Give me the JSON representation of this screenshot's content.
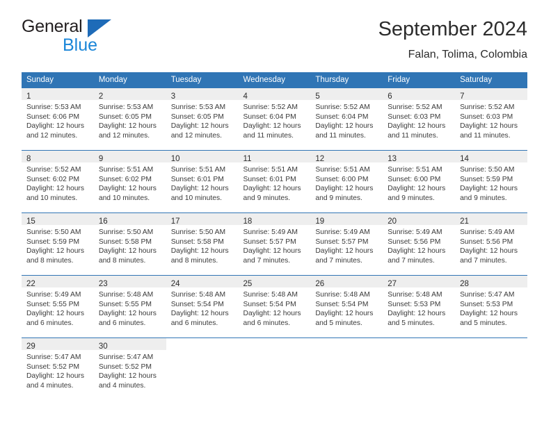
{
  "brand": {
    "word_general": "General",
    "word_blue": "Blue",
    "triangle_color": "#1e6bb8",
    "blue_text_color": "#1b86d8"
  },
  "header": {
    "title": "September 2024",
    "location": "Falan, Tolima, Colombia"
  },
  "theme": {
    "header_blue": "#3075b5",
    "daynum_band": "#eeeeee",
    "text": "#3a3a3a"
  },
  "weekday_headers": [
    "Sunday",
    "Monday",
    "Tuesday",
    "Wednesday",
    "Thursday",
    "Friday",
    "Saturday"
  ],
  "labels": {
    "sunrise_prefix": "Sunrise:",
    "sunset_prefix": "Sunset:",
    "daylight_prefix": "Daylight:"
  },
  "weeks": [
    [
      {
        "day": "1",
        "sunrise": "Sunrise: 5:53 AM",
        "sunset": "Sunset: 6:06 PM",
        "daylight_1": "Daylight: 12 hours",
        "daylight_2": "and 12 minutes."
      },
      {
        "day": "2",
        "sunrise": "Sunrise: 5:53 AM",
        "sunset": "Sunset: 6:05 PM",
        "daylight_1": "Daylight: 12 hours",
        "daylight_2": "and 12 minutes."
      },
      {
        "day": "3",
        "sunrise": "Sunrise: 5:53 AM",
        "sunset": "Sunset: 6:05 PM",
        "daylight_1": "Daylight: 12 hours",
        "daylight_2": "and 12 minutes."
      },
      {
        "day": "4",
        "sunrise": "Sunrise: 5:52 AM",
        "sunset": "Sunset: 6:04 PM",
        "daylight_1": "Daylight: 12 hours",
        "daylight_2": "and 11 minutes."
      },
      {
        "day": "5",
        "sunrise": "Sunrise: 5:52 AM",
        "sunset": "Sunset: 6:04 PM",
        "daylight_1": "Daylight: 12 hours",
        "daylight_2": "and 11 minutes."
      },
      {
        "day": "6",
        "sunrise": "Sunrise: 5:52 AM",
        "sunset": "Sunset: 6:03 PM",
        "daylight_1": "Daylight: 12 hours",
        "daylight_2": "and 11 minutes."
      },
      {
        "day": "7",
        "sunrise": "Sunrise: 5:52 AM",
        "sunset": "Sunset: 6:03 PM",
        "daylight_1": "Daylight: 12 hours",
        "daylight_2": "and 11 minutes."
      }
    ],
    [
      {
        "day": "8",
        "sunrise": "Sunrise: 5:52 AM",
        "sunset": "Sunset: 6:02 PM",
        "daylight_1": "Daylight: 12 hours",
        "daylight_2": "and 10 minutes."
      },
      {
        "day": "9",
        "sunrise": "Sunrise: 5:51 AM",
        "sunset": "Sunset: 6:02 PM",
        "daylight_1": "Daylight: 12 hours",
        "daylight_2": "and 10 minutes."
      },
      {
        "day": "10",
        "sunrise": "Sunrise: 5:51 AM",
        "sunset": "Sunset: 6:01 PM",
        "daylight_1": "Daylight: 12 hours",
        "daylight_2": "and 10 minutes."
      },
      {
        "day": "11",
        "sunrise": "Sunrise: 5:51 AM",
        "sunset": "Sunset: 6:01 PM",
        "daylight_1": "Daylight: 12 hours",
        "daylight_2": "and 9 minutes."
      },
      {
        "day": "12",
        "sunrise": "Sunrise: 5:51 AM",
        "sunset": "Sunset: 6:00 PM",
        "daylight_1": "Daylight: 12 hours",
        "daylight_2": "and 9 minutes."
      },
      {
        "day": "13",
        "sunrise": "Sunrise: 5:51 AM",
        "sunset": "Sunset: 6:00 PM",
        "daylight_1": "Daylight: 12 hours",
        "daylight_2": "and 9 minutes."
      },
      {
        "day": "14",
        "sunrise": "Sunrise: 5:50 AM",
        "sunset": "Sunset: 5:59 PM",
        "daylight_1": "Daylight: 12 hours",
        "daylight_2": "and 9 minutes."
      }
    ],
    [
      {
        "day": "15",
        "sunrise": "Sunrise: 5:50 AM",
        "sunset": "Sunset: 5:59 PM",
        "daylight_1": "Daylight: 12 hours",
        "daylight_2": "and 8 minutes."
      },
      {
        "day": "16",
        "sunrise": "Sunrise: 5:50 AM",
        "sunset": "Sunset: 5:58 PM",
        "daylight_1": "Daylight: 12 hours",
        "daylight_2": "and 8 minutes."
      },
      {
        "day": "17",
        "sunrise": "Sunrise: 5:50 AM",
        "sunset": "Sunset: 5:58 PM",
        "daylight_1": "Daylight: 12 hours",
        "daylight_2": "and 8 minutes."
      },
      {
        "day": "18",
        "sunrise": "Sunrise: 5:49 AM",
        "sunset": "Sunset: 5:57 PM",
        "daylight_1": "Daylight: 12 hours",
        "daylight_2": "and 7 minutes."
      },
      {
        "day": "19",
        "sunrise": "Sunrise: 5:49 AM",
        "sunset": "Sunset: 5:57 PM",
        "daylight_1": "Daylight: 12 hours",
        "daylight_2": "and 7 minutes."
      },
      {
        "day": "20",
        "sunrise": "Sunrise: 5:49 AM",
        "sunset": "Sunset: 5:56 PM",
        "daylight_1": "Daylight: 12 hours",
        "daylight_2": "and 7 minutes."
      },
      {
        "day": "21",
        "sunrise": "Sunrise: 5:49 AM",
        "sunset": "Sunset: 5:56 PM",
        "daylight_1": "Daylight: 12 hours",
        "daylight_2": "and 7 minutes."
      }
    ],
    [
      {
        "day": "22",
        "sunrise": "Sunrise: 5:49 AM",
        "sunset": "Sunset: 5:55 PM",
        "daylight_1": "Daylight: 12 hours",
        "daylight_2": "and 6 minutes."
      },
      {
        "day": "23",
        "sunrise": "Sunrise: 5:48 AM",
        "sunset": "Sunset: 5:55 PM",
        "daylight_1": "Daylight: 12 hours",
        "daylight_2": "and 6 minutes."
      },
      {
        "day": "24",
        "sunrise": "Sunrise: 5:48 AM",
        "sunset": "Sunset: 5:54 PM",
        "daylight_1": "Daylight: 12 hours",
        "daylight_2": "and 6 minutes."
      },
      {
        "day": "25",
        "sunrise": "Sunrise: 5:48 AM",
        "sunset": "Sunset: 5:54 PM",
        "daylight_1": "Daylight: 12 hours",
        "daylight_2": "and 6 minutes."
      },
      {
        "day": "26",
        "sunrise": "Sunrise: 5:48 AM",
        "sunset": "Sunset: 5:54 PM",
        "daylight_1": "Daylight: 12 hours",
        "daylight_2": "and 5 minutes."
      },
      {
        "day": "27",
        "sunrise": "Sunrise: 5:48 AM",
        "sunset": "Sunset: 5:53 PM",
        "daylight_1": "Daylight: 12 hours",
        "daylight_2": "and 5 minutes."
      },
      {
        "day": "28",
        "sunrise": "Sunrise: 5:47 AM",
        "sunset": "Sunset: 5:53 PM",
        "daylight_1": "Daylight: 12 hours",
        "daylight_2": "and 5 minutes."
      }
    ],
    [
      {
        "day": "29",
        "sunrise": "Sunrise: 5:47 AM",
        "sunset": "Sunset: 5:52 PM",
        "daylight_1": "Daylight: 12 hours",
        "daylight_2": "and 4 minutes."
      },
      {
        "day": "30",
        "sunrise": "Sunrise: 5:47 AM",
        "sunset": "Sunset: 5:52 PM",
        "daylight_1": "Daylight: 12 hours",
        "daylight_2": "and 4 minutes."
      },
      {
        "day": "",
        "sunrise": "",
        "sunset": "",
        "daylight_1": "",
        "daylight_2": ""
      },
      {
        "day": "",
        "sunrise": "",
        "sunset": "",
        "daylight_1": "",
        "daylight_2": ""
      },
      {
        "day": "",
        "sunrise": "",
        "sunset": "",
        "daylight_1": "",
        "daylight_2": ""
      },
      {
        "day": "",
        "sunrise": "",
        "sunset": "",
        "daylight_1": "",
        "daylight_2": ""
      },
      {
        "day": "",
        "sunrise": "",
        "sunset": "",
        "daylight_1": "",
        "daylight_2": ""
      }
    ]
  ]
}
